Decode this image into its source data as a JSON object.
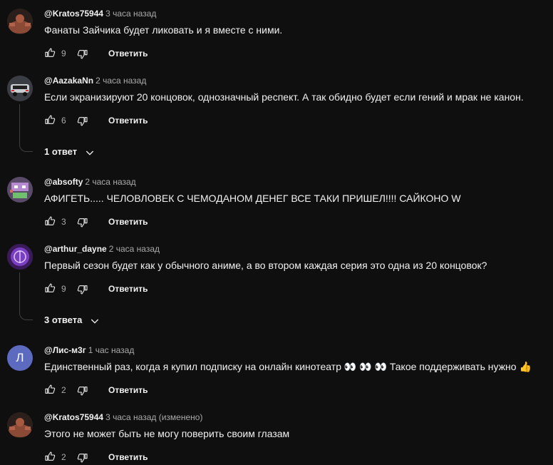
{
  "comments": [
    {
      "author": "@Kratos75944",
      "time": "3 часа назад",
      "text": "Фанаты Зайчика будет ликовать и я вместе с ними.",
      "likes": "9",
      "reply_label": "Ответить",
      "avatar_icon": "muscle-man-avatar"
    },
    {
      "author": "@AazakaNn",
      "time": "2 часа назад",
      "text": "Если экранизируют 20 концовок, однозначный респект. А так обидно будет если гений и мрак не канон.",
      "likes": "6",
      "reply_label": "Ответить",
      "replies_label": "1 ответ",
      "avatar_icon": "car-avatar"
    },
    {
      "author": "@absofty",
      "time": "2 часа назад",
      "text": "АФИГЕТЬ..... ЧЕЛОВЛОВЕК С ЧЕМОДАНОМ ДЕНЕГ ВСЕ ТАКИ ПРИШЕЛ!!!! САЙКОНО W",
      "likes": "3",
      "reply_label": "Ответить",
      "avatar_icon": "pixel-face-avatar"
    },
    {
      "author": "@arthur_dayne",
      "time": "2 часа назад",
      "text": "Первый сезон будет как у обычного аниме, а во втором каждая серия это одна из 20 концовок?",
      "likes": "9",
      "reply_label": "Ответить",
      "replies_label": "3 ответа",
      "avatar_icon": "purple-emblem-avatar"
    },
    {
      "author": "@Лис-м3г",
      "time": "1 час назад",
      "text": "Единственный раз, когда я купил подписку на онлайн кинотеатр 👀 👀 👀 Такое поддерживать нужно 👍",
      "likes": "2",
      "reply_label": "Ответить",
      "avatar_letter": "Л",
      "avatar_color": "#5c6bc0"
    },
    {
      "author": "@Kratos75944",
      "time": "3 часа назад (изменено)",
      "text": "Этого не может быть не могу поверить своим глазам",
      "likes": "2",
      "reply_label": "Ответить",
      "avatar_icon": "muscle-man-avatar"
    }
  ]
}
